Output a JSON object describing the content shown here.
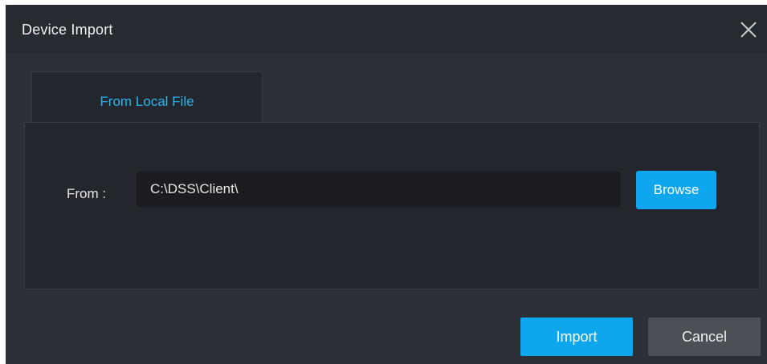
{
  "dialog": {
    "title": "Device Import",
    "close_icon": "close-icon"
  },
  "tabs": [
    {
      "label": "From Local File",
      "active": true
    }
  ],
  "form": {
    "from_label": "From :",
    "path_value": "C:\\DSS\\Client\\",
    "browse_label": "Browse"
  },
  "footer": {
    "import_label": "Import",
    "cancel_label": "Cancel"
  },
  "colors": {
    "accent": "#0ea6ec",
    "tab_text": "#2bb4ee",
    "dialog_bg": "#2c3038",
    "panel_bg": "#23272d",
    "cancel_bg": "#4b5057"
  }
}
